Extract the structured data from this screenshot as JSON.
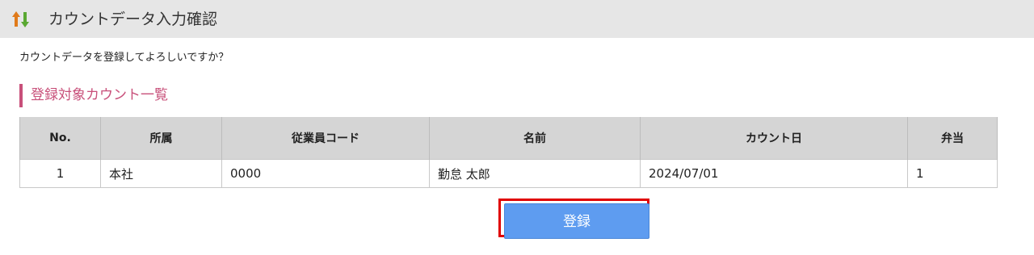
{
  "header": {
    "title": "カウントデータ入力確認",
    "icon": "sort-arrows-icon"
  },
  "message": "カウントデータを登録してよろしいですか？",
  "section": {
    "title": "登録対象カウント一覧"
  },
  "table": {
    "columns": [
      "No.",
      "所属",
      "従業員コード",
      "名前",
      "カウント日",
      "弁当"
    ],
    "rows": [
      [
        "1",
        "本社",
        "0000",
        "勤怠 太郎",
        "2024/07/01",
        "1"
      ]
    ]
  },
  "actions": {
    "register_label": "登録"
  },
  "colors": {
    "accent": "#c8507a",
    "button": "#5e9cf0",
    "highlight": "#e00000"
  }
}
